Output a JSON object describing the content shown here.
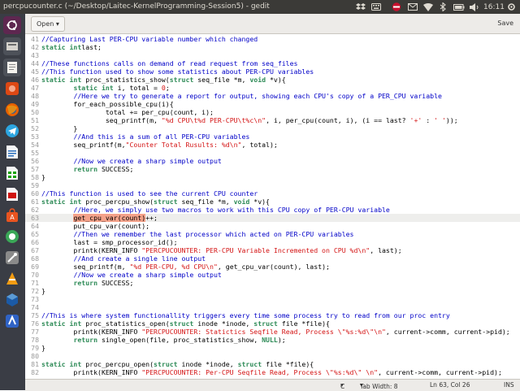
{
  "window": {
    "title": "percpucounter.c (~/Desktop/Laitec-KernelProgramming-Session5) - gedit"
  },
  "indicators": {
    "time": "16:11"
  },
  "toolbar": {
    "open_label": "Open",
    "open_arrow": "▾",
    "save_label": "Save"
  },
  "launcher": {
    "items": [
      "ubuntu-logo-icon",
      "files-icon",
      "firefox-icon",
      "telegram-icon",
      "writer-icon",
      "calc-icon",
      "impress-icon",
      "software-center-icon",
      "settings-icon",
      "shotwell-icon",
      "vlc-icon",
      "virtualbox-icon",
      "trash-icon"
    ]
  },
  "status": {
    "language": "C",
    "tab_width": "Tab Width: 8",
    "position": "Ln 63, Col 26",
    "mode": "INS"
  },
  "editor": {
    "lines": [
      {
        "n": "41",
        "segs": [
          [
            "comment",
            "//Capturing Last PER-CPU variable number which changed"
          ]
        ]
      },
      {
        "n": "42",
        "segs": [
          [
            "kw",
            "static int"
          ],
          [
            "",
            "last;"
          ]
        ]
      },
      {
        "n": "43",
        "segs": []
      },
      {
        "n": "44",
        "segs": [
          [
            "comment",
            "//These functions calls on demand of read request from seq_files"
          ]
        ]
      },
      {
        "n": "45",
        "segs": [
          [
            "comment",
            "//This function used to show some statistics about PER-CPU variables"
          ]
        ]
      },
      {
        "n": "46",
        "segs": [
          [
            "kw",
            "static int"
          ],
          [
            "",
            " proc_statistics_show("
          ],
          [
            "kw",
            "struct"
          ],
          [
            "",
            " seq_file *m, "
          ],
          [
            "kw",
            "void"
          ],
          [
            "",
            " *v){"
          ]
        ]
      },
      {
        "n": "47",
        "segs": [
          [
            "",
            "        "
          ],
          [
            "kw",
            "static int"
          ],
          [
            "",
            " i, total = "
          ],
          [
            "str",
            "0"
          ],
          [
            "",
            ";"
          ]
        ]
      },
      {
        "n": "48",
        "segs": [
          [
            "",
            "        "
          ],
          [
            "comment",
            "//Here we try to generate a report for output, showing each CPU's copy of a PER_CPU variable"
          ]
        ]
      },
      {
        "n": "49",
        "segs": [
          [
            "",
            "        for_each_possible_cpu(i){"
          ]
        ]
      },
      {
        "n": "50",
        "segs": [
          [
            "",
            "                total += per_cpu(count, i);"
          ]
        ]
      },
      {
        "n": "51",
        "segs": [
          [
            "",
            "                seq_printf(m, "
          ],
          [
            "str",
            "\"%d CPU\\t%d PER-CPU\\t%c\\n\""
          ],
          [
            "",
            ", i, per_cpu(count, i), (i == last? "
          ],
          [
            "str",
            "'+'"
          ],
          [
            "",
            " : "
          ],
          [
            "str",
            "' '"
          ],
          [
            "",
            "));"
          ]
        ]
      },
      {
        "n": "52",
        "segs": [
          [
            "",
            "        }"
          ]
        ]
      },
      {
        "n": "53",
        "segs": [
          [
            "",
            "        "
          ],
          [
            "comment",
            "//And this is a sum of all PER-CPU variables"
          ]
        ]
      },
      {
        "n": "54",
        "segs": [
          [
            "",
            "        seq_printf(m,"
          ],
          [
            "str",
            "\"Counter Total Rusults: %d\\n\""
          ],
          [
            "",
            ", total);"
          ]
        ]
      },
      {
        "n": "55",
        "segs": []
      },
      {
        "n": "56",
        "segs": [
          [
            "",
            "        "
          ],
          [
            "comment",
            "//Now we create a sharp simple output"
          ]
        ]
      },
      {
        "n": "57",
        "segs": [
          [
            "",
            "        "
          ],
          [
            "kw",
            "return"
          ],
          [
            "",
            " SUCCESS;"
          ]
        ]
      },
      {
        "n": "58",
        "segs": [
          [
            "",
            "}"
          ]
        ]
      },
      {
        "n": "59",
        "segs": []
      },
      {
        "n": "60",
        "segs": [
          [
            "comment",
            "//This function is used to see the current CPU counter"
          ]
        ]
      },
      {
        "n": "61",
        "segs": [
          [
            "kw",
            "static int"
          ],
          [
            "",
            " proc_percpu_show("
          ],
          [
            "kw",
            "struct"
          ],
          [
            "",
            " seq_file *m, "
          ],
          [
            "kw",
            "void"
          ],
          [
            "",
            " *v){"
          ]
        ]
      },
      {
        "n": "62",
        "segs": [
          [
            "",
            "        "
          ],
          [
            "comment",
            "//Here, we simply use two macros to work with this CPU copy of PER-CPU variable"
          ]
        ]
      },
      {
        "n": "63",
        "segs": [
          [
            "",
            "        "
          ],
          [
            "hl",
            "get_cpu_var(count)"
          ],
          [
            "",
            "++;"
          ]
        ]
      },
      {
        "n": "64",
        "segs": [
          [
            "",
            "        put_cpu_var(count);"
          ]
        ]
      },
      {
        "n": "65",
        "segs": [
          [
            "",
            "        "
          ],
          [
            "comment",
            "//Then we remember the last processor which acted on PER-CPU variables"
          ]
        ]
      },
      {
        "n": "66",
        "segs": [
          [
            "",
            "        last = smp_processor_id();"
          ]
        ]
      },
      {
        "n": "67",
        "segs": [
          [
            "",
            "        printk(KERN_INFO "
          ],
          [
            "str",
            "\"PERCPUCOUNTER: PER-CPU Variable Incremented on CPU %d\\n\""
          ],
          [
            "",
            ", last);"
          ]
        ]
      },
      {
        "n": "68",
        "segs": [
          [
            "",
            "        "
          ],
          [
            "comment",
            "//And create a single line output"
          ]
        ]
      },
      {
        "n": "69",
        "segs": [
          [
            "",
            "        seq_printf(m, "
          ],
          [
            "str",
            "\"%d PER-CPU, %d CPU\\n\""
          ],
          [
            "",
            ", get_cpu_var(count), last);"
          ]
        ]
      },
      {
        "n": "70",
        "segs": [
          [
            "",
            "        "
          ],
          [
            "comment",
            "//Now we create a sharp simple output"
          ]
        ]
      },
      {
        "n": "71",
        "segs": [
          [
            "",
            "        "
          ],
          [
            "kw",
            "return"
          ],
          [
            "",
            " SUCCESS;"
          ]
        ]
      },
      {
        "n": "72",
        "segs": [
          [
            "",
            "}"
          ]
        ]
      },
      {
        "n": "73",
        "segs": []
      },
      {
        "n": "74",
        "segs": []
      },
      {
        "n": "75",
        "segs": [
          [
            "comment",
            "//This is where system functionallity triggers every time some process try to read from our proc entry"
          ]
        ]
      },
      {
        "n": "76",
        "segs": [
          [
            "kw",
            "static int"
          ],
          [
            "",
            " proc_statistics_open("
          ],
          [
            "kw",
            "struct"
          ],
          [
            "",
            " inode *inode, "
          ],
          [
            "kw",
            "struct"
          ],
          [
            "",
            " file *file){"
          ]
        ]
      },
      {
        "n": "77",
        "segs": [
          [
            "",
            "        printk(KERN_INFO "
          ],
          [
            "str",
            "\"PERCPUCOUNTER: Statictics Seqfile Read, Process \\\"%s:%d\\\"\\n\""
          ],
          [
            "",
            ", current->comm, current->pid);"
          ]
        ]
      },
      {
        "n": "78",
        "segs": [
          [
            "",
            "        "
          ],
          [
            "kw",
            "return"
          ],
          [
            "",
            " single_open(file, proc_statistics_show, "
          ],
          [
            "kw",
            "NULL"
          ],
          [
            "",
            ");"
          ]
        ]
      },
      {
        "n": "79",
        "segs": [
          [
            "",
            "}"
          ]
        ]
      },
      {
        "n": "80",
        "segs": []
      },
      {
        "n": "81",
        "segs": [
          [
            "kw",
            "static int"
          ],
          [
            "",
            " proc_percpu_open("
          ],
          [
            "kw",
            "struct"
          ],
          [
            "",
            " inode *inode, "
          ],
          [
            "kw",
            "struct"
          ],
          [
            "",
            " file *file){"
          ]
        ]
      },
      {
        "n": "82",
        "segs": [
          [
            "",
            "        printk(KERN_INFO "
          ],
          [
            "str",
            "\"PERCPUCOUNTER: Per-CPU Seqfile Read, Process \\\"%s:%d\\\" \\n\""
          ],
          [
            "",
            ", current->comm, current->pid);"
          ]
        ]
      }
    ]
  }
}
